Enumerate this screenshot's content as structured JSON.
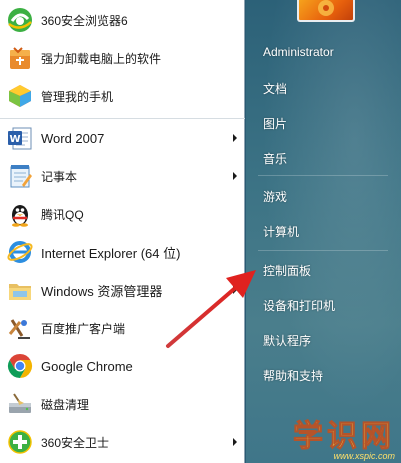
{
  "start_menu": {
    "programs": [
      {
        "label": "360安全浏览器6",
        "icon": "360-browser-icon",
        "submenu": false
      },
      {
        "label": "强力卸载电脑上的软件",
        "icon": "uninstall-box-icon",
        "submenu": false
      },
      {
        "label": "管理我的手机",
        "icon": "phone-manager-icon",
        "submenu": false
      },
      {
        "label": "Word 2007",
        "icon": "word-icon",
        "submenu": true
      },
      {
        "label": "记事本",
        "icon": "notepad-icon",
        "submenu": true
      },
      {
        "label": "腾讯QQ",
        "icon": "qq-penguin-icon",
        "submenu": false
      },
      {
        "label": "Internet Explorer (64 位)",
        "icon": "internet-explorer-icon",
        "submenu": false
      },
      {
        "label": "Windows 资源管理器",
        "icon": "explorer-folder-icon",
        "submenu": true
      },
      {
        "label": "百度推广客户端",
        "icon": "baidu-client-icon",
        "submenu": false
      },
      {
        "label": "Google Chrome",
        "icon": "chrome-icon",
        "submenu": false
      },
      {
        "label": "磁盘清理",
        "icon": "disk-cleanup-icon",
        "submenu": false
      },
      {
        "label": "360安全卫士",
        "icon": "360-safeguard-icon",
        "submenu": true
      }
    ],
    "right_items": [
      {
        "label": "Administrator"
      },
      {
        "label": "文档"
      },
      {
        "label": "图片"
      },
      {
        "label": "音乐"
      },
      {
        "label": "游戏"
      },
      {
        "label": "计算机"
      },
      {
        "label": "控制面板"
      },
      {
        "label": "设备和打印机"
      },
      {
        "label": "默认程序"
      },
      {
        "label": "帮助和支持"
      }
    ],
    "user_picture": "user-flower-picture",
    "highlight_arrow_color": "#e0221f"
  },
  "watermark": {
    "chars": "学识网",
    "url": "www.xspic.com"
  }
}
